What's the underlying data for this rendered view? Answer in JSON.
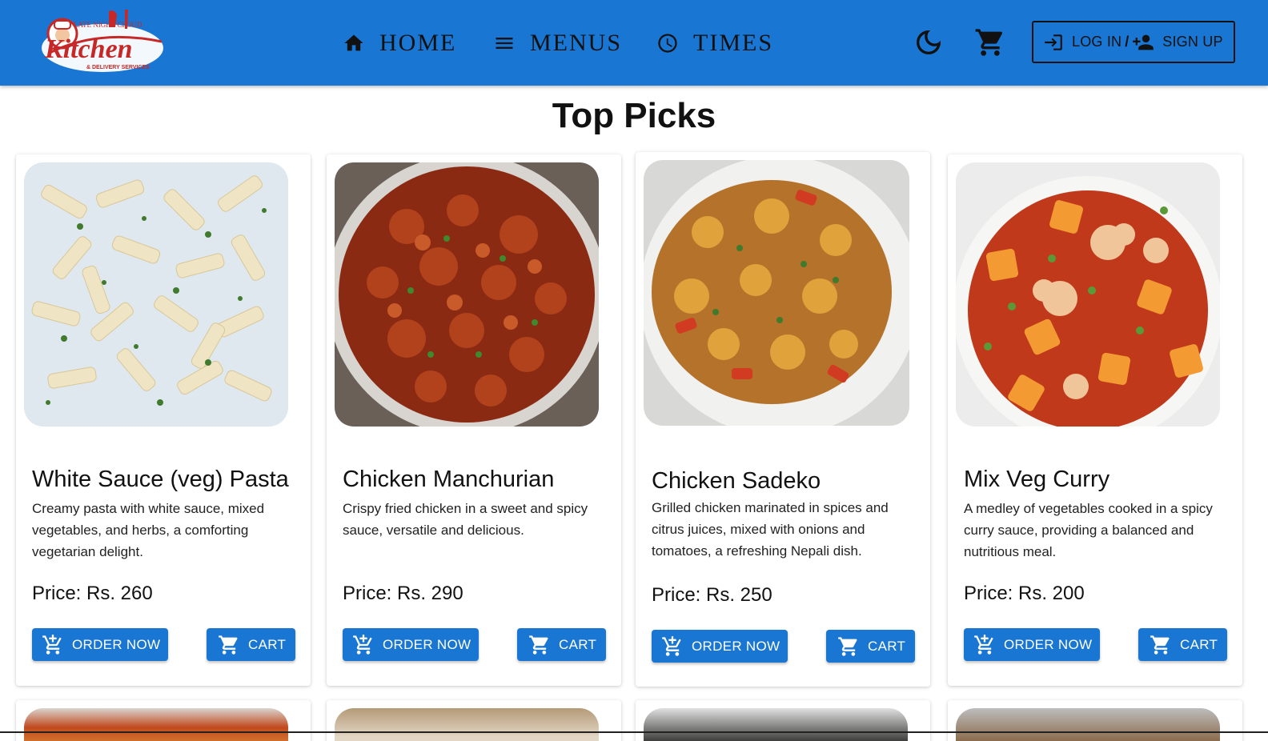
{
  "brand": {
    "logo_text": "Kitchen",
    "logo_top_text": "LATE NIGHT CLOUD",
    "logo_bottom_text": "& DELIVERY SERVICES"
  },
  "nav": {
    "home": "HOME",
    "menus": "MENUS",
    "times": "TIMES"
  },
  "auth": {
    "login": "LOG IN",
    "separator": "/",
    "signup": "SIGN UP"
  },
  "section": {
    "title": "Top Picks"
  },
  "items": [
    {
      "name": "White Sauce (veg) Pasta",
      "description": "Creamy pasta with white sauce, mixed vegetables, and herbs, a comforting vegetarian delight.",
      "price": "Price: Rs. 260",
      "order_label": "ORDER NOW",
      "cart_label": "CART"
    },
    {
      "name": "Chicken Manchurian",
      "description": "Crispy fried chicken in a sweet and spicy sauce, versatile and delicious.",
      "price": "Price: Rs. 290",
      "order_label": "ORDER NOW",
      "cart_label": "CART"
    },
    {
      "name": "Chicken Sadeko",
      "description": "Grilled chicken marinated in spices and citrus juices, mixed with onions and tomatoes, a refreshing Nepali dish.",
      "price": "Price: Rs. 250",
      "order_label": "ORDER NOW",
      "cart_label": "CART"
    },
    {
      "name": "Mix Veg Curry",
      "description": "A medley of vegetables cooked in a spicy curry sauce, providing a balanced and nutritious meal.",
      "price": "Price: Rs. 200",
      "order_label": "ORDER NOW",
      "cart_label": "CART"
    }
  ],
  "icons": {
    "home": "home-icon",
    "menus": "menu-icon",
    "times": "clock-icon",
    "theme": "dark-mode-moon-icon",
    "cart": "shopping-cart-icon",
    "login": "login-icon",
    "signup": "person-add-icon",
    "order": "add-shopping-cart-icon"
  },
  "colors": {
    "primary": "#1976d2",
    "text": "#111111",
    "background": "#ffffff"
  }
}
